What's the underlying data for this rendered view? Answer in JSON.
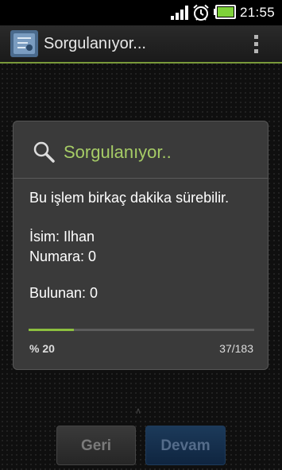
{
  "status_bar": {
    "time": "21:55",
    "signal_icon": "signal-bars-icon",
    "alarm_icon": "alarm-clock-icon",
    "battery_icon": "battery-icon",
    "battery_level": 0.75,
    "battery_color": "#7fd23a"
  },
  "action_bar": {
    "title": "Sorgulanıyor...",
    "app_icon": "app-icon",
    "menu_icon": "overflow-menu-icon",
    "accent_color": "#7a9a3a"
  },
  "dialog": {
    "title": "Sorgulanıyor..",
    "title_color": "#a6cc66",
    "icon": "search-icon",
    "message": "Bu işlem birkaç dakika sürebilir.",
    "name_line": "İsim: Ilhan",
    "number_line": "Numara: 0",
    "found_line": "Bulunan: 0",
    "progress": {
      "fraction": 0.2,
      "percent_label": "% 20",
      "count_label": "37/183",
      "bar_color": "#8cbf3f"
    }
  },
  "buttons": {
    "back_label": "Geri",
    "next_label": "Devam"
  }
}
